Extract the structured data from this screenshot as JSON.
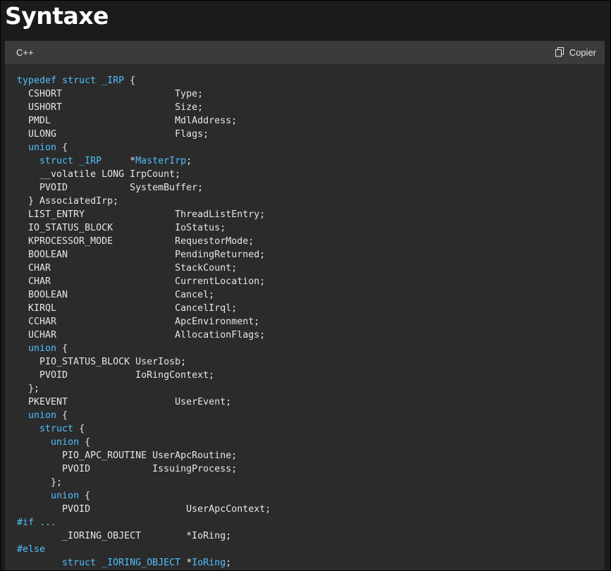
{
  "heading": "Syntaxe",
  "code_block": {
    "language": "C++",
    "copy_label": "Copier",
    "copy_icon": "copy-icon",
    "lines": [
      [
        [
          "kw",
          "typedef"
        ],
        [
          "t",
          " "
        ],
        [
          "kw",
          "struct"
        ],
        [
          "t",
          " "
        ],
        [
          "ty",
          "_IRP"
        ],
        [
          "t",
          " {"
        ]
      ],
      [
        [
          "t",
          "  CSHORT                    Type;"
        ]
      ],
      [
        [
          "t",
          "  USHORT                    Size;"
        ]
      ],
      [
        [
          "t",
          "  PMDL                      MdlAddress;"
        ]
      ],
      [
        [
          "t",
          "  ULONG                     Flags;"
        ]
      ],
      [
        [
          "t",
          "  "
        ],
        [
          "kw",
          "union"
        ],
        [
          "t",
          " {"
        ]
      ],
      [
        [
          "t",
          "    "
        ],
        [
          "kw",
          "struct"
        ],
        [
          "t",
          " "
        ],
        [
          "ty",
          "_IRP"
        ],
        [
          "t",
          "     *"
        ],
        [
          "ty",
          "MasterIrp"
        ],
        [
          "t",
          ";"
        ]
      ],
      [
        [
          "t",
          "    __volatile LONG IrpCount;"
        ]
      ],
      [
        [
          "t",
          "    PVOID           SystemBuffer;"
        ]
      ],
      [
        [
          "t",
          "  } AssociatedIrp;"
        ]
      ],
      [
        [
          "t",
          "  LIST_ENTRY                ThreadListEntry;"
        ]
      ],
      [
        [
          "t",
          "  IO_STATUS_BLOCK           IoStatus;"
        ]
      ],
      [
        [
          "t",
          "  KPROCESSOR_MODE           RequestorMode;"
        ]
      ],
      [
        [
          "t",
          "  BOOLEAN                   PendingReturned;"
        ]
      ],
      [
        [
          "t",
          "  CHAR                      StackCount;"
        ]
      ],
      [
        [
          "t",
          "  CHAR                      CurrentLocation;"
        ]
      ],
      [
        [
          "t",
          "  BOOLEAN                   Cancel;"
        ]
      ],
      [
        [
          "t",
          "  KIRQL                     CancelIrql;"
        ]
      ],
      [
        [
          "t",
          "  CCHAR                     ApcEnvironment;"
        ]
      ],
      [
        [
          "t",
          "  UCHAR                     AllocationFlags;"
        ]
      ],
      [
        [
          "t",
          "  "
        ],
        [
          "kw",
          "union"
        ],
        [
          "t",
          " {"
        ]
      ],
      [
        [
          "t",
          "    PIO_STATUS_BLOCK UserIosb;"
        ]
      ],
      [
        [
          "t",
          "    PVOID            IoRingContext;"
        ]
      ],
      [
        [
          "t",
          "  };"
        ]
      ],
      [
        [
          "t",
          "  PKEVENT                   UserEvent;"
        ]
      ],
      [
        [
          "t",
          "  "
        ],
        [
          "kw",
          "union"
        ],
        [
          "t",
          " {"
        ]
      ],
      [
        [
          "t",
          "    "
        ],
        [
          "kw",
          "struct"
        ],
        [
          "t",
          " {"
        ]
      ],
      [
        [
          "t",
          "      "
        ],
        [
          "kw",
          "union"
        ],
        [
          "t",
          " {"
        ]
      ],
      [
        [
          "t",
          "        PIO_APC_ROUTINE UserApcRoutine;"
        ]
      ],
      [
        [
          "t",
          "        PVOID           IssuingProcess;"
        ]
      ],
      [
        [
          "t",
          "      };"
        ]
      ],
      [
        [
          "t",
          "      "
        ],
        [
          "kw",
          "union"
        ],
        [
          "t",
          " {"
        ]
      ],
      [
        [
          "t",
          "        PVOID                 UserApcContext;"
        ]
      ],
      [
        [
          "kw",
          "#if ..."
        ]
      ],
      [
        [
          "t",
          "        _IORING_OBJECT        *IoRing;"
        ]
      ],
      [
        [
          "kw",
          "#else"
        ]
      ],
      [
        [
          "t",
          "        "
        ],
        [
          "kw",
          "struct"
        ],
        [
          "t",
          " "
        ],
        [
          "ty",
          "_IORING_OBJECT"
        ],
        [
          "t",
          " *"
        ],
        [
          "ty",
          "IoRing"
        ],
        [
          "t",
          ";"
        ]
      ]
    ]
  }
}
